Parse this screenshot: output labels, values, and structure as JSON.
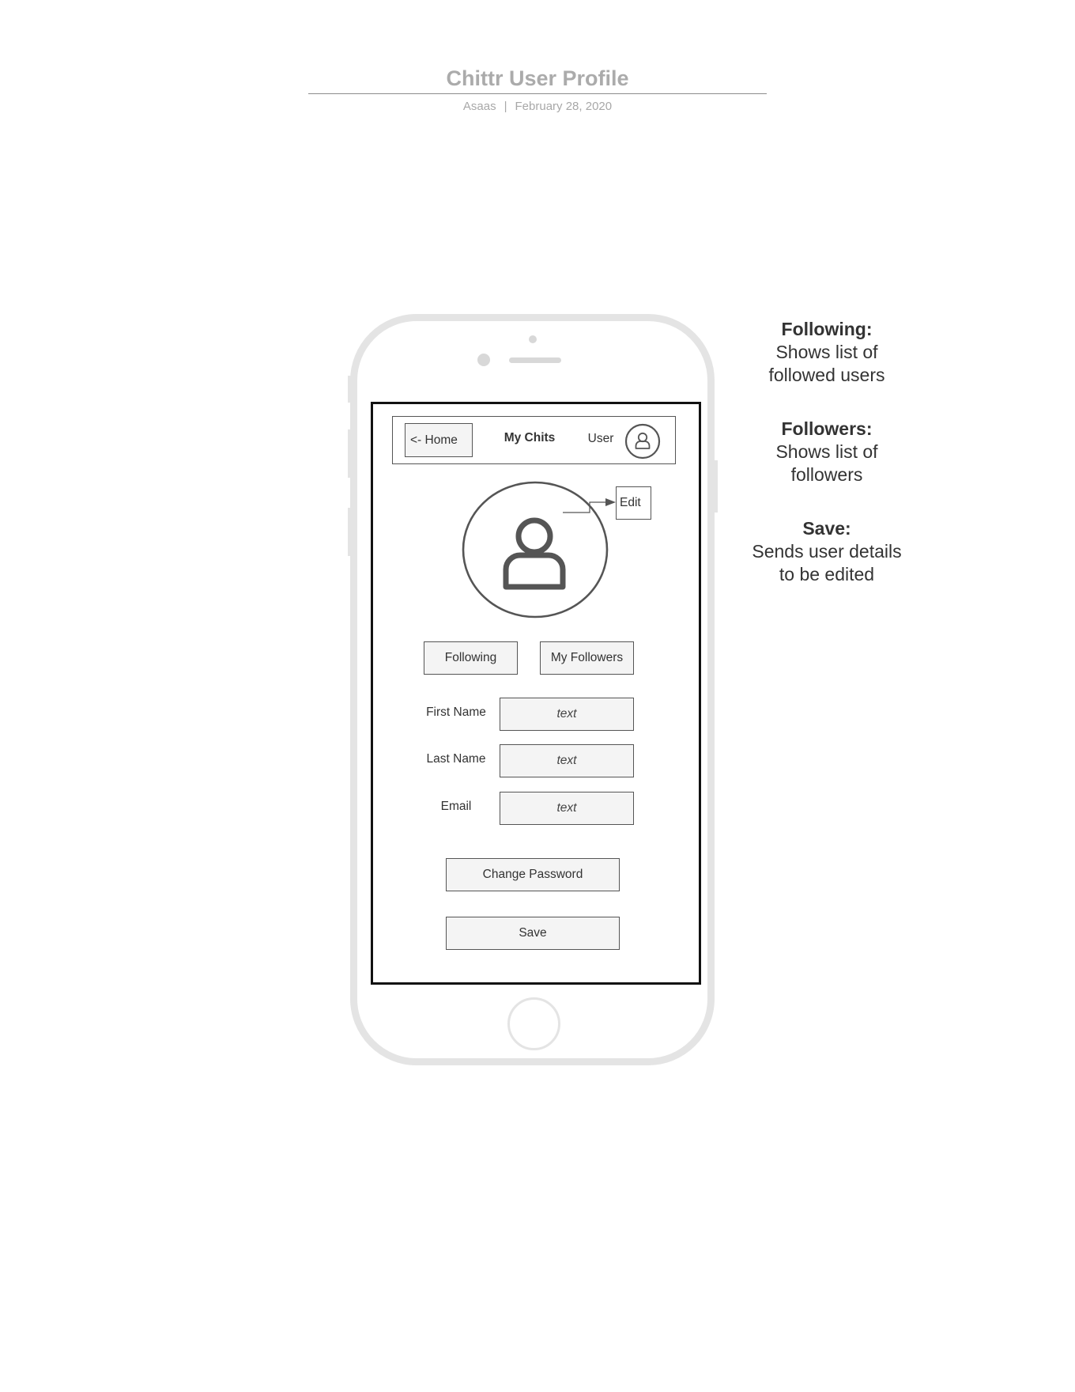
{
  "document": {
    "title": "Chittr User Profile",
    "author": "Asaas",
    "separator": "|",
    "date": "February 28, 2020"
  },
  "app_header": {
    "home_link": "<- Home",
    "my_chits": "My Chits",
    "user_label": "User",
    "avatar_icon": "user-circle-icon"
  },
  "profile": {
    "avatar_icon": "user-silhouette-icon",
    "edit_label": "Edit"
  },
  "social": {
    "following_label": "Following",
    "followers_label": "My Followers"
  },
  "form": {
    "fields": [
      {
        "label": "First Name",
        "value": "text"
      },
      {
        "label": "Last Name",
        "value": "text"
      },
      {
        "label": "Email",
        "value": "text"
      }
    ],
    "change_password_label": "Change Password",
    "save_label": "Save"
  },
  "notes": [
    {
      "heading": "Following:",
      "lines": [
        "Shows list of",
        "followed users"
      ]
    },
    {
      "heading": "Followers:",
      "lines": [
        "Shows list of",
        "followers"
      ]
    },
    {
      "heading": "Save:",
      "lines": [
        "Sends user details",
        "to be edited"
      ]
    }
  ],
  "colors": {
    "frame": "#e4e4e4",
    "box_fill": "#f4f4f4",
    "outline": "#555555",
    "title": "#ababab"
  }
}
